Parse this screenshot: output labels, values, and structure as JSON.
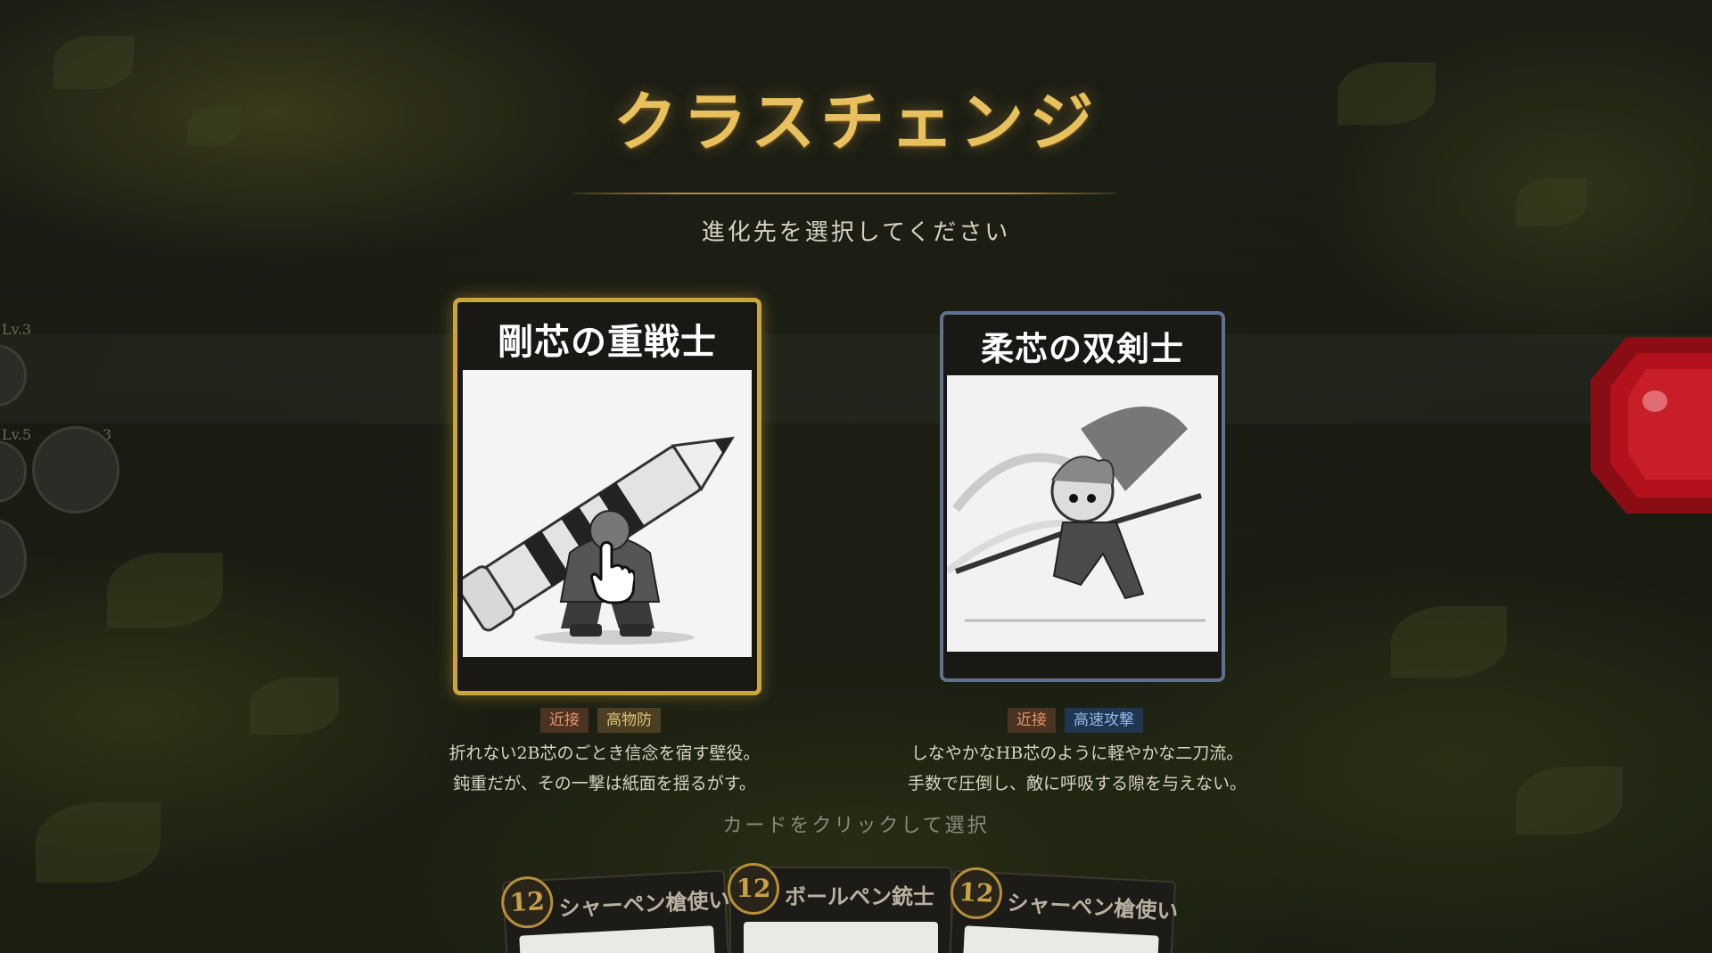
{
  "screen": {
    "title": "クラスチェンジ",
    "subtitle": "進化先を選択してください",
    "hint": "カードをクリックして選択"
  },
  "classes": [
    {
      "name": "剛芯の重戦士",
      "selected": true,
      "art_icon": "giant-pencil-warrior-icon",
      "tags": [
        "近接",
        "高物防"
      ],
      "description": [
        "折れない2B芯のごとき信念を宿す壁役。",
        "鈍重だが、その一撃は紙面を揺るがす。"
      ]
    },
    {
      "name": "柔芯の双剣士",
      "selected": false,
      "art_icon": "dual-sword-warrior-icon",
      "tags": [
        "近接",
        "高速攻撃"
      ],
      "description": [
        "しなやかなHB芯のように軽やかな二刀流。",
        "手数で圧倒し、敵に呼吸する隙を与えない。"
      ]
    }
  ],
  "side_panel": {
    "levels": [
      "Lv.3",
      "Lv.5",
      "Lv.3"
    ]
  },
  "hand": [
    {
      "cost": "12",
      "name": "シャーペン槍使い"
    },
    {
      "cost": "12",
      "name": "ボールペン銃士"
    },
    {
      "cost": "12",
      "name": "シャーペン槍使い"
    }
  ],
  "colors": {
    "title_gold": "#e8c15e",
    "selected_border": "#c9a53c",
    "normal_border": "#5f718e",
    "tag_melee": "#e5956a",
    "tag_defense": "#e0c27a",
    "tag_speed": "#8fbbe8",
    "gem_red": "#b3121c"
  }
}
